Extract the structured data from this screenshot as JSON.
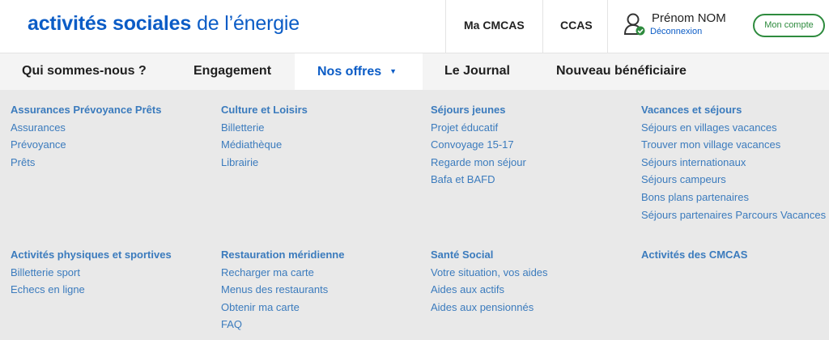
{
  "header": {
    "logo_bold": "activités sociales",
    "logo_light": "de l’énergie",
    "links": [
      "Ma CMCAS",
      "CCAS"
    ],
    "user_name": "Prénom NOM",
    "logout": "Déconnexion",
    "account_button": "Mon compte",
    "user_icon": "user-icon",
    "brand_color": "#0b5cc6",
    "account_color": "#2e8b3e"
  },
  "nav": {
    "items": [
      "Qui sommes-nous ?",
      "Engagement",
      "Nos offres",
      "Le Journal",
      "Nouveau bénéficiaire"
    ],
    "active": "Nos offres",
    "caret_icon": "▼"
  },
  "menu": {
    "rows": [
      [
        {
          "title": "Assurances Prévoyance Prêts",
          "links": [
            "Assurances",
            "Prévoyance",
            "Prêts"
          ]
        },
        {
          "title": "Culture et Loisirs",
          "links": [
            "Billetterie",
            "Médiathèque",
            "Librairie"
          ]
        },
        {
          "title": "Séjours jeunes",
          "links": [
            "Projet éducatif",
            "Convoyage 15-17",
            "Regarde mon séjour",
            "Bafa et BAFD"
          ]
        },
        {
          "title": "Vacances et séjours",
          "links": [
            "Séjours en villages vacances",
            "Trouver mon village vacances",
            "Séjours internationaux",
            "Séjours campeurs",
            "Bons plans partenaires",
            "Séjours partenaires Parcours Vacances"
          ]
        }
      ],
      [
        {
          "title": "Activités physiques et sportives",
          "links": [
            "Billetterie sport",
            "Echecs en ligne"
          ]
        },
        {
          "title": "Restauration méridienne",
          "links": [
            "Recharger ma carte",
            "Menus des restaurants",
            "Obtenir ma carte",
            "FAQ"
          ]
        },
        {
          "title": "Santé Social",
          "links": [
            "Votre situation, vos aides",
            "Aides aux actifs",
            "Aides aux pensionnés"
          ]
        },
        {
          "title": "Activités des CMCAS",
          "links": []
        }
      ]
    ]
  }
}
